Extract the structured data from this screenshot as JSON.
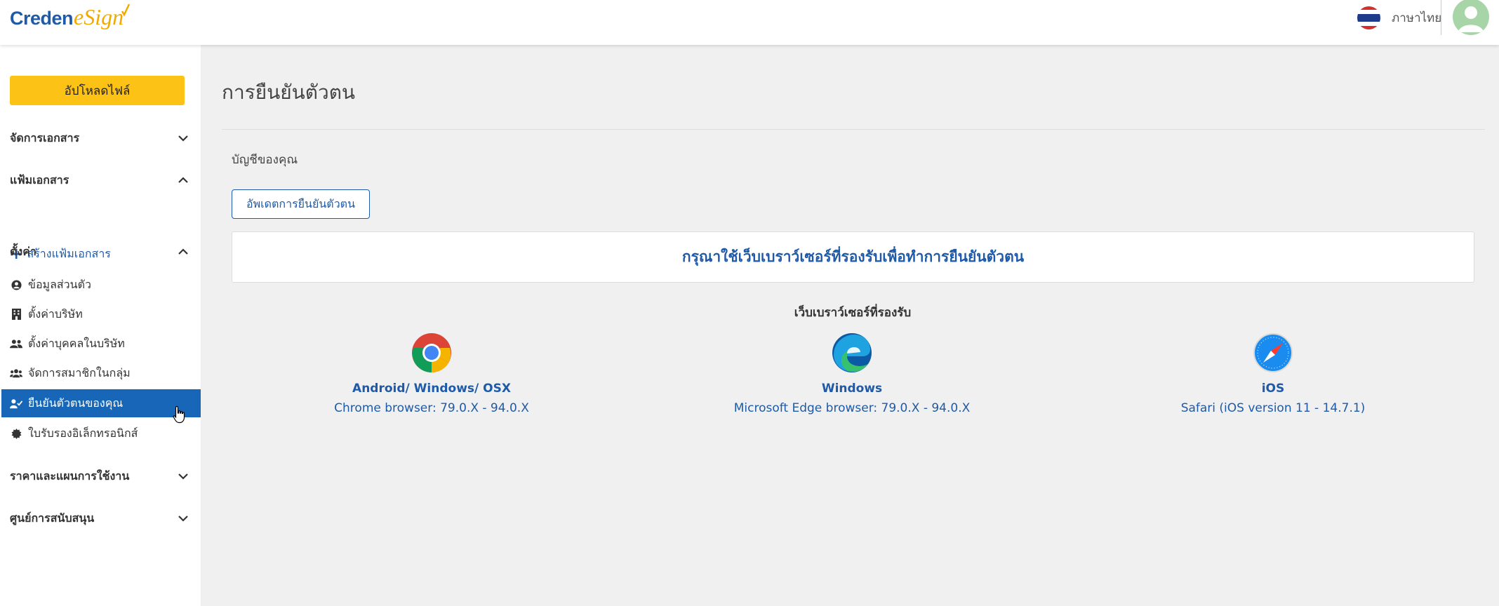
{
  "header": {
    "logo_part1": "Creden",
    "logo_part2": "eSign",
    "language": "ภาษาไทย"
  },
  "sidebar": {
    "upload_label": "อัปโหลดไฟล์",
    "sections": {
      "manage_docs": "จัดการเอกสาร",
      "folders": "แฟ้มเอกสาร",
      "create_folder": "สร้างแฟ้มเอกสาร",
      "settings": "ตั้งค่า",
      "pricing": "ราคาและแผนการใช้งาน",
      "support": "ศูนย์การสนับสนุน"
    },
    "items": [
      {
        "label": "ข้อมูลส่วนตัว",
        "icon": "user-circle-icon"
      },
      {
        "label": "ตั้งค่าบริษัท",
        "icon": "building-icon"
      },
      {
        "label": "ตั้งค่าบุคคลในบริษัท",
        "icon": "users-icon"
      },
      {
        "label": "จัดการสมาชิกในกลุ่ม",
        "icon": "user-group-icon"
      },
      {
        "label": "ยืนยันตัวตนของคุณ",
        "icon": "user-check-icon",
        "active": true
      },
      {
        "label": "ใบรับรองอิเล็กทรอนิกส์",
        "icon": "certificate-icon"
      }
    ]
  },
  "main": {
    "title": "การยืนยันตัวตน",
    "account_label": "บัญชีของคุณ",
    "update_button": "อัพเดตการยืนยันตัวตน",
    "notice": "กรุณาใช้เว็บเบราว์เซอร์ที่รองรับเพื่อทำการยืนยันตัวตน",
    "supported_title": "เว็บเบราว์เซอร์ที่รองรับ",
    "browsers": [
      {
        "platform": "Android/ Windows/ OSX",
        "version": "Chrome browser: 79.0.X - 94.0.X",
        "icon": "chrome-icon"
      },
      {
        "platform": "Windows",
        "version": "Microsoft Edge browser: 79.0.X - 94.0.X",
        "icon": "edge-icon"
      },
      {
        "platform": "iOS",
        "version": "Safari (iOS version 11 - 14.7.1)",
        "icon": "safari-icon"
      }
    ]
  },
  "colors": {
    "brand_blue": "#1e5aa8",
    "accent_yellow": "#fdc216",
    "active_item": "#1766b8"
  }
}
